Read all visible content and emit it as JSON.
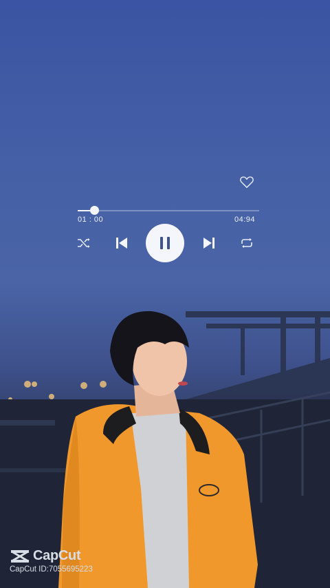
{
  "player": {
    "elapsed": "01 : 00",
    "duration": "04:94",
    "progress_fraction": 0.09,
    "state": "playing",
    "liked": false
  },
  "icons": {
    "heart": "heart-outline-icon",
    "shuffle": "shuffle-icon",
    "previous": "skip-previous-icon",
    "play_pause": "pause-icon",
    "next": "skip-next-icon",
    "repeat": "repeat-icon",
    "brand": "capcut-logo-icon"
  },
  "watermark": {
    "brand_name": "CapCut",
    "capcut_id": "CapCut ID:7055695223"
  },
  "colors": {
    "sky": "#4560a6",
    "controls": "#f4f6fc",
    "jacket": "#f0982c"
  }
}
